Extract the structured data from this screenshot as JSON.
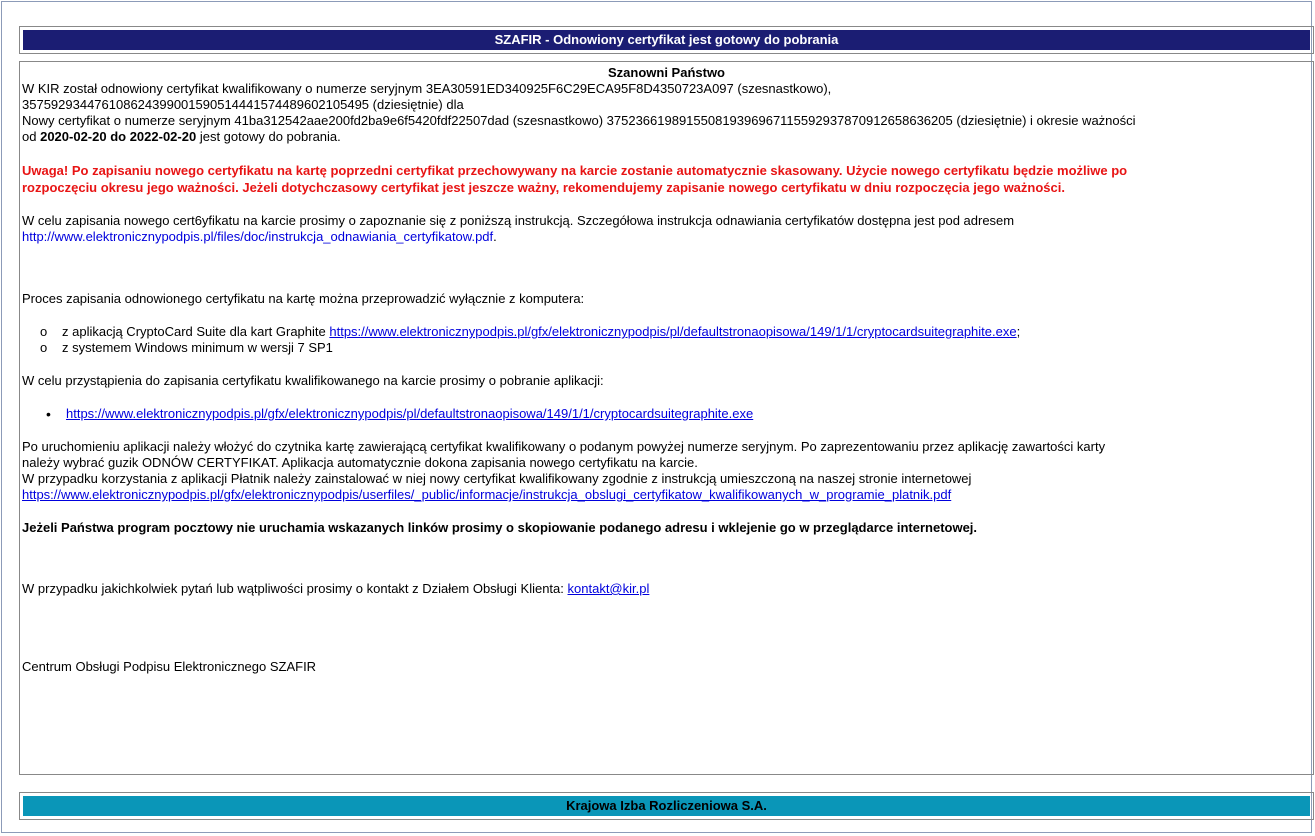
{
  "header": {
    "title": "SZAFIR - Odnowiony certyfikat jest gotowy do pobrania"
  },
  "greeting": "Szanowni Państwo",
  "intro": {
    "line1": "W KIR został odnowiony certyfikat kwalifikowany o numerze seryjnym 3EA30591ED340925F6C29ECA95F8D4350723A097 (szesnastkowo),",
    "line2": "357592934476108624399001590514441574489602105495 (dziesiętnie) dla",
    "line3": "Nowy certyfikat o numerze seryjnym 41ba312542aae200fd2ba9e6f5420fdf22507dad (szesnastkowo) 375236619891550819396967115592937870912658636205 (dziesiętnie) i okresie ważności",
    "line4_prefix": "od",
    "dates": "2020-02-20 do 2022-02-20",
    "line4_suffix": "jest gotowy do pobrania."
  },
  "warning": {
    "line1": "Uwaga! Po zapisaniu nowego certyfikatu na kartę poprzedni certyfikat przechowywany na karcie zostanie automatycznie skasowany. Użycie nowego certyfikatu będzie możliwe po",
    "line2": "rozpoczęciu okresu jego ważności. Jeżeli dotychczasowy certyfikat jest jeszcze ważny, rekomendujemy zapisanie nowego certyfikatu w dniu rozpoczęcia jego ważności."
  },
  "instruction": {
    "text": "W celu zapisania nowego cert6yfikatu na karcie prosimy o zapoznanie się z poniższą instrukcją. Szczegółowa instrukcja odnawiania certyfikatów dostępna jest pod adresem",
    "link": "http://www.elektronicznypodpis.pl/files/doc/instrukcja_odnawiania_certyfikatow.pdf",
    "link_suffix": "."
  },
  "process": {
    "text": "Proces zapisania odnowionego certyfikatu na kartę można przeprowadzić wyłącznie z komputera:",
    "bullet": "o",
    "item1_text": "z aplikacją CryptoCard Suite dla kart Graphite",
    "item1_link": "https://www.elektronicznypodpis.pl/gfx/elektronicznypodpis/pl/defaultstronaopisowa/149/1/1/cryptocardsuitegraphite.exe",
    "item1_suffix": ";",
    "item2_text": "z systemem Windows minimum w wersji 7 SP1"
  },
  "download": {
    "text": "W celu przystąpienia do zapisania certyfikatu kwalifikowanego na karcie prosimy o pobranie aplikacji:",
    "bullet": "•",
    "link": "https://www.elektronicznypodpis.pl/gfx/elektronicznypodpis/pl/defaultstronaopisowa/149/1/1/cryptocardsuitegraphite.exe"
  },
  "after": {
    "line1": "Po uruchomieniu aplikacji należy włożyć do czytnika kartę zawierającą certyfikat kwalifikowany o podanym powyżej numerze seryjnym. Po zaprezentowaniu przez aplikację zawartości karty",
    "line2": "należy wybrać guzik ODNÓW CERTYFIKAT. Aplikacja automatycznie dokona zapisania nowego certyfikatu na karcie.",
    "line3": "W przypadku korzystania z aplikacji Płatnik należy zainstalować w niej nowy certyfikat kwalifikowany zgodnie z instrukcją umieszczoną na naszej stronie internetowej",
    "link": "https://www.elektronicznypodpis.pl/gfx/elektronicznypodpis/userfiles/_public/informacje/instrukcja_obslugi_certyfikatow_kwalifikowanych_w_programie_platnik.pdf"
  },
  "notice": "Jeżeli Państwa program pocztowy nie uruchamia wskazanych linków prosimy o skopiowanie podanego adresu i wklejenie go w przeglądarce internetowej.",
  "contact": {
    "text": "W przypadku jakichkolwiek pytań lub wątpliwości prosimy o kontakt z Działem Obsługi Klienta:",
    "email": "kontakt@kir.pl"
  },
  "signature": "Centrum Obsługi Podpisu Elektronicznego SZAFIR",
  "footer": {
    "title": "Krajowa Izba Rozliczeniowa S.A."
  },
  "colors": {
    "header_bg": "#1b1d73",
    "footer_bg": "#0a96b8",
    "warning": "#e81414",
    "link": "#0000dd"
  }
}
